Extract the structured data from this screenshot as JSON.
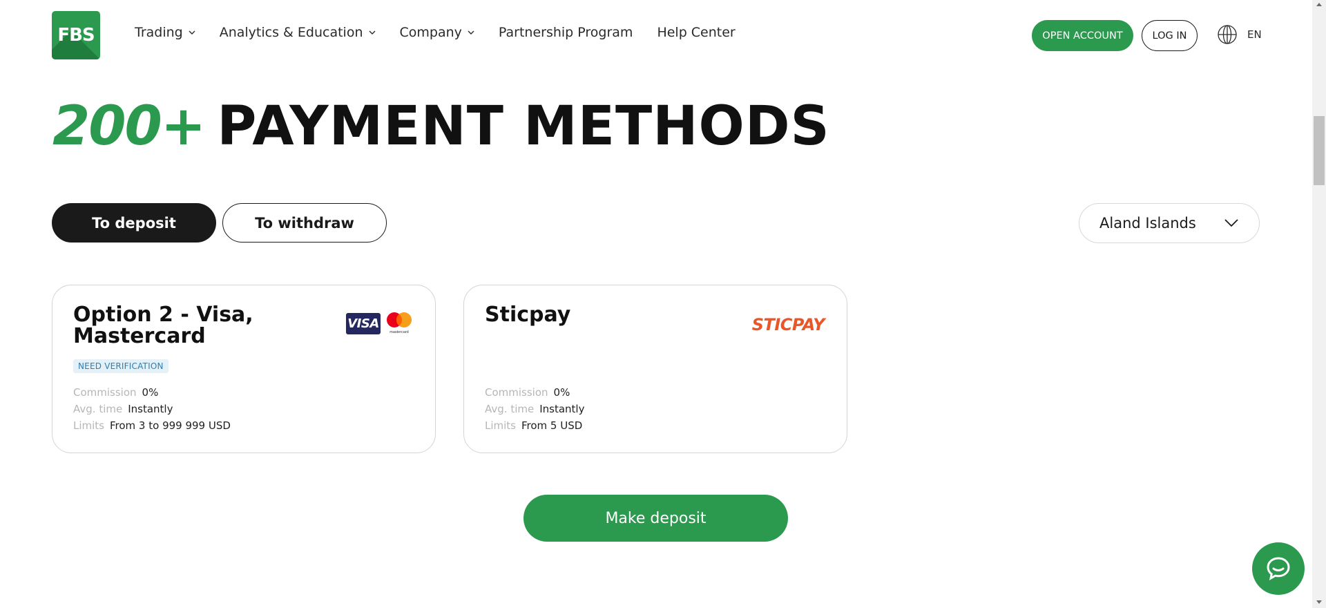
{
  "brand": {
    "logo_text": "FBS",
    "primary_color": "#2b9a4f",
    "dark_color": "#1a1a1a"
  },
  "nav": {
    "items": [
      {
        "label": "Trading",
        "has_dropdown": true
      },
      {
        "label": "Analytics & Education",
        "has_dropdown": true
      },
      {
        "label": "Company",
        "has_dropdown": true
      },
      {
        "label": "Partnership Program",
        "has_dropdown": false
      },
      {
        "label": "Help Center",
        "has_dropdown": false
      }
    ],
    "open_account_label": "OPEN ACCOUNT",
    "login_label": "LOG IN",
    "language": "EN",
    "language_icon": "globe-icon"
  },
  "hero": {
    "accent": "200+",
    "title": "PAYMENT METHODS"
  },
  "tabs": {
    "deposit": "To deposit",
    "withdraw": "To withdraw",
    "active": "deposit"
  },
  "country_select": {
    "selected": "Aland Islands",
    "icon": "chevron-down-icon"
  },
  "methods": [
    {
      "name": "Option 2 - Visa, Mastercard",
      "badge": "NEED VERIFICATION",
      "logos": [
        "VISA",
        "mastercard"
      ],
      "commission_label": "Commission",
      "commission": "0%",
      "time_label": "Avg. time",
      "time": "Instantly",
      "limits_label": "Limits",
      "limits": "From 3 to 999 999 USD"
    },
    {
      "name": "Sticpay",
      "logo_text": "STICPAY",
      "commission_label": "Commission",
      "commission": "0%",
      "time_label": "Avg. time",
      "time": "Instantly",
      "limits_label": "Limits",
      "limits": "From 5 USD"
    }
  ],
  "cta": {
    "make_deposit": "Make deposit"
  },
  "chat": {
    "icon": "chat-bubble-icon"
  }
}
